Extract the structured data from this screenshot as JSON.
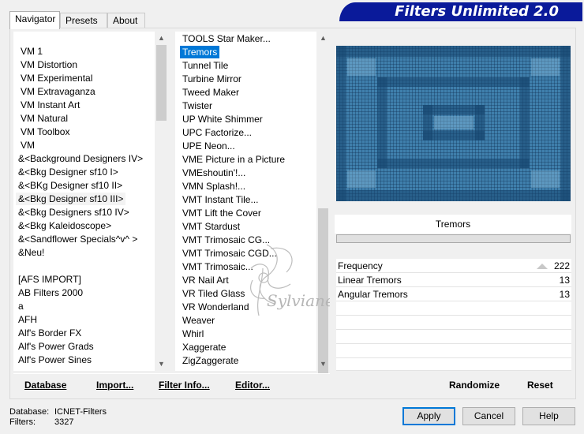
{
  "tabs": [
    {
      "label": "Navigator",
      "active": true
    },
    {
      "label": "Presets",
      "active": false
    },
    {
      "label": "About",
      "active": false
    }
  ],
  "banner_title": "Filters Unlimited 2.0",
  "categories": [
    "VM 1",
    "VM Distortion",
    "VM Experimental",
    "VM Extravaganza",
    "VM Instant Art",
    "VM Natural",
    "VM Toolbox",
    "VM",
    "&<Background Designers IV>",
    "&<Bkg Designer sf10 I>",
    "&<BKg Designer sf10 II>",
    "&<Bkg Designer sf10 III>",
    "&<Bkg Designers sf10 IV>",
    "&<Bkg Kaleidoscope>",
    "&<Sandflower Specials^v^ >",
    "&Neu!",
    "",
    "[AFS IMPORT]",
    "AB Filters 2000",
    "a",
    "AFH",
    "Alf's Border FX",
    "Alf's Power Grads",
    "Alf's Power Sines"
  ],
  "categories_highlighted_index": 11,
  "filters": [
    "TOOLS Star Maker...",
    "Tremors",
    "Tunnel Tile",
    "Turbine Mirror",
    "Tweed Maker",
    "Twister",
    "UP White Shimmer",
    "UPC Factorize...",
    "UPE Neon...",
    "VME Picture in a Picture",
    "VMEshoutin'!...",
    "VMN Splash!...",
    "VMT Instant Tile...",
    "VMT Lift the Cover",
    "VMT Stardust",
    "VMT Trimosaic CG...",
    "VMT Trimosaic CGD...",
    "VMT Trimosaic...",
    "VR Nail Art",
    "VR Tiled Glass",
    "VR Wonderland",
    "Weaver",
    "Whirl",
    "Xaggerate",
    "ZigZaggerate"
  ],
  "filters_selected_index": 1,
  "filter_name": "Tremors",
  "params": [
    {
      "label": "Frequency",
      "value": "222"
    },
    {
      "label": "Linear Tremors",
      "value": "13"
    },
    {
      "label": "Angular Tremors",
      "value": "13"
    }
  ],
  "toolbar": {
    "database": "Database",
    "import": "Import...",
    "filter_info": "Filter Info...",
    "editor": "Editor...",
    "randomize": "Randomize",
    "reset": "Reset"
  },
  "status": {
    "database_label": "Database:",
    "database_value": "ICNET-Filters",
    "filters_label": "Filters:",
    "filters_value": "3327"
  },
  "dialog_buttons": {
    "apply": "Apply",
    "cancel": "Cancel",
    "help": "Help"
  },
  "watermark_text": "Sylviane",
  "colors": {
    "banner": "#0a1a9a",
    "selection": "#0078d7",
    "preview": "#3f7fac"
  }
}
